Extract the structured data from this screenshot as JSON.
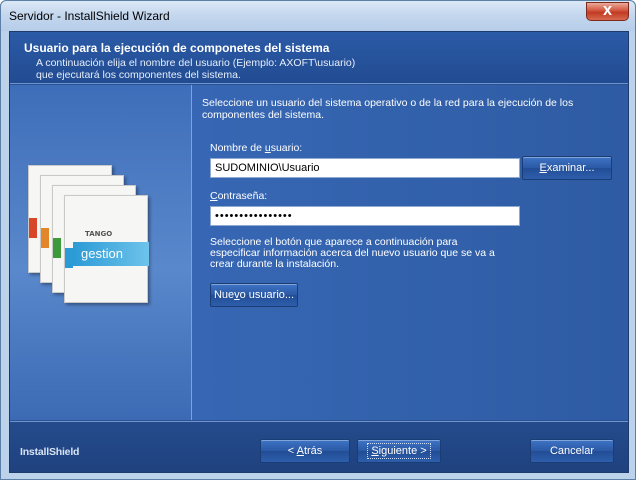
{
  "window": {
    "title": "Servidor - InstallShield Wizard",
    "close_label": "X"
  },
  "header": {
    "title": "Usuario para la ejecución de componetes del sistema",
    "description": "A continuación elija el nombre del usuario (Ejemplo: AXOFT\\usuario) que ejecutará los componentes del sistema."
  },
  "body": {
    "intro": "Seleccione un usuario del sistema operativo o de la red para la ejecución de los componentes del sistema.",
    "username_label": "Nombre de usuario:",
    "username_value": "SUDOMINIO\\Usuario",
    "examinar_label": "Examinar...",
    "password_label": "Contraseña:",
    "password_value": "••••••••••••••••",
    "note": "Seleccione el botón que aparece a continuación para especificar información acerca del nuevo usuario que se va a crear durante la instalación.",
    "new_user_label": "Nuevo usuario..."
  },
  "product_box": {
    "brand": "TANGO",
    "name": "gestion"
  },
  "footer": {
    "brand": "InstallShield",
    "back_label": "< Atrás",
    "next_label": "Siguiente >",
    "cancel_label": "Cancelar"
  },
  "colors": {
    "panel_blue": "#2a5193",
    "accent_light": "#2b9bd6"
  }
}
